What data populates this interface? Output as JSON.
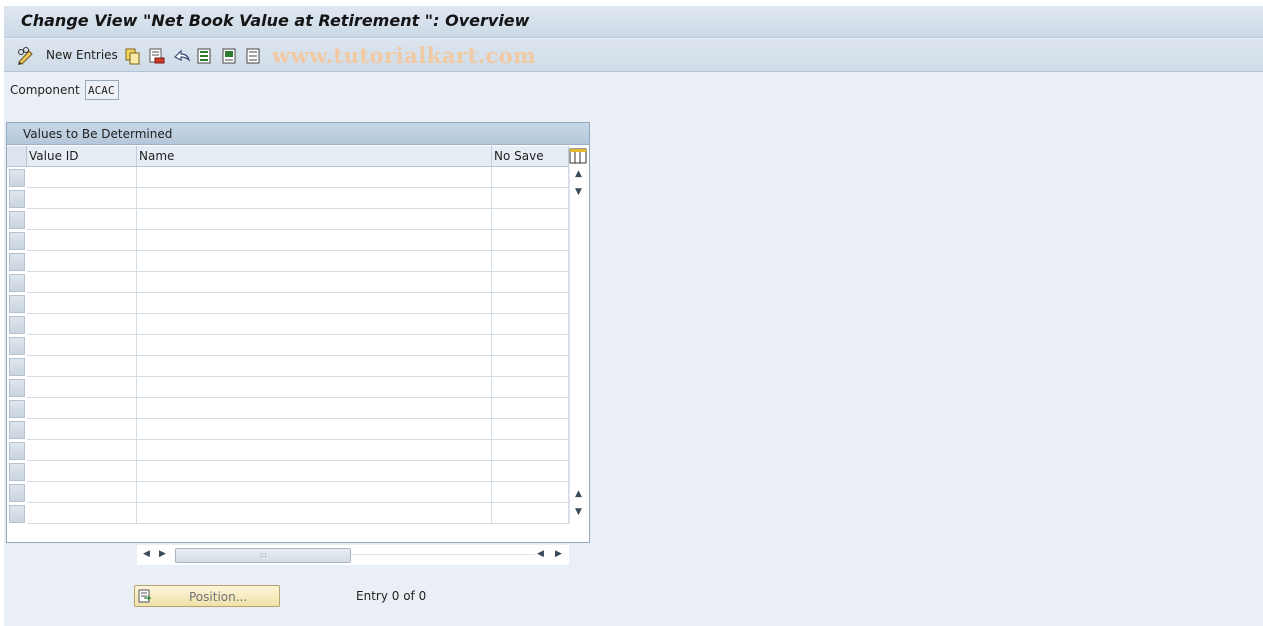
{
  "window": {
    "title": "Change View \"Net Book Value at Retirement \": Overview"
  },
  "toolbar": {
    "new_entries_label": "New Entries",
    "icons": [
      "display-change-icon",
      "copy-icon",
      "delete-icon",
      "undo-icon",
      "select-all-icon",
      "select-block-icon",
      "deselect-all-icon"
    ],
    "watermark": "www.tutorialkart.com"
  },
  "component": {
    "label": "Component",
    "value": "ACAC"
  },
  "table": {
    "title": "Values to Be Determined",
    "columns": [
      "Value ID",
      "Name",
      "No Save"
    ],
    "rows": []
  },
  "footer": {
    "position_button": "Position...",
    "entry_status": "Entry 0 of 0"
  },
  "colors": {
    "background": "#e9eff5",
    "header_bar": "#ccd9e6",
    "button_accent": "#f1e2a8"
  }
}
